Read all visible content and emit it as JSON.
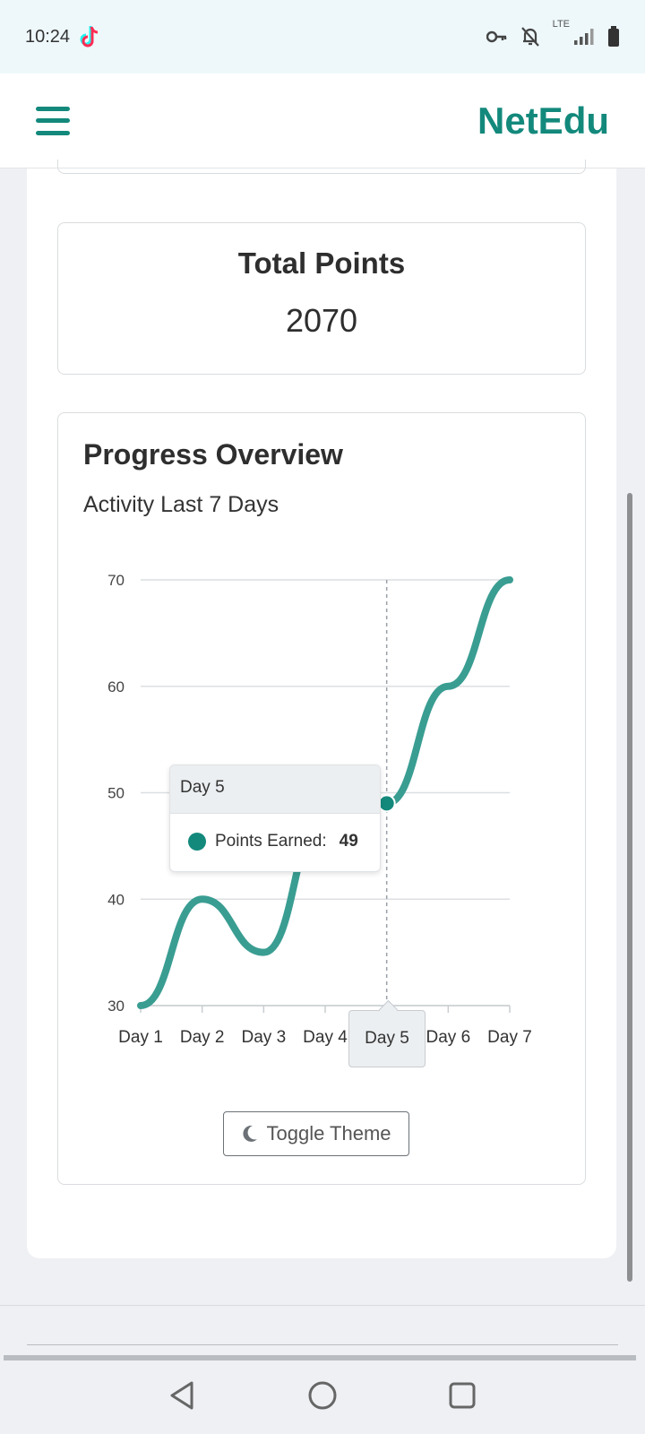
{
  "status_bar": {
    "time": "10:24",
    "network_label": "LTE",
    "icons": [
      "tiktok-icon",
      "key-icon",
      "bell-off-icon",
      "signal-icon",
      "battery-icon"
    ]
  },
  "header": {
    "brand": "NetEdu",
    "menu_icon": "hamburger-icon",
    "brand_color": "#13897c"
  },
  "points_card": {
    "title": "Total Points",
    "value": "2070"
  },
  "progress_card": {
    "title": "Progress Overview",
    "subtitle": "Activity Last 7 Days",
    "toggle_label": "Toggle Theme",
    "toggle_icon": "moon-icon"
  },
  "tooltip": {
    "title": "Day 5",
    "label": "Points Earned:",
    "value": "49"
  },
  "highlighted_x": "Day 5",
  "chart_data": {
    "type": "line",
    "categories": [
      "Day 1",
      "Day 2",
      "Day 3",
      "Day 4",
      "Day 5",
      "Day 6",
      "Day 7"
    ],
    "series": [
      {
        "name": "Points Earned",
        "values": [
          30,
          40,
          35,
          48,
          49,
          60,
          70
        ],
        "color": "#3a9d92"
      }
    ],
    "yticks": [
      30,
      40,
      50,
      60,
      70
    ],
    "ylim": [
      30,
      70
    ],
    "grid": true,
    "highlighted_index": 4
  },
  "nav_bar": {
    "buttons": [
      "back-icon",
      "home-icon",
      "recents-icon"
    ]
  }
}
